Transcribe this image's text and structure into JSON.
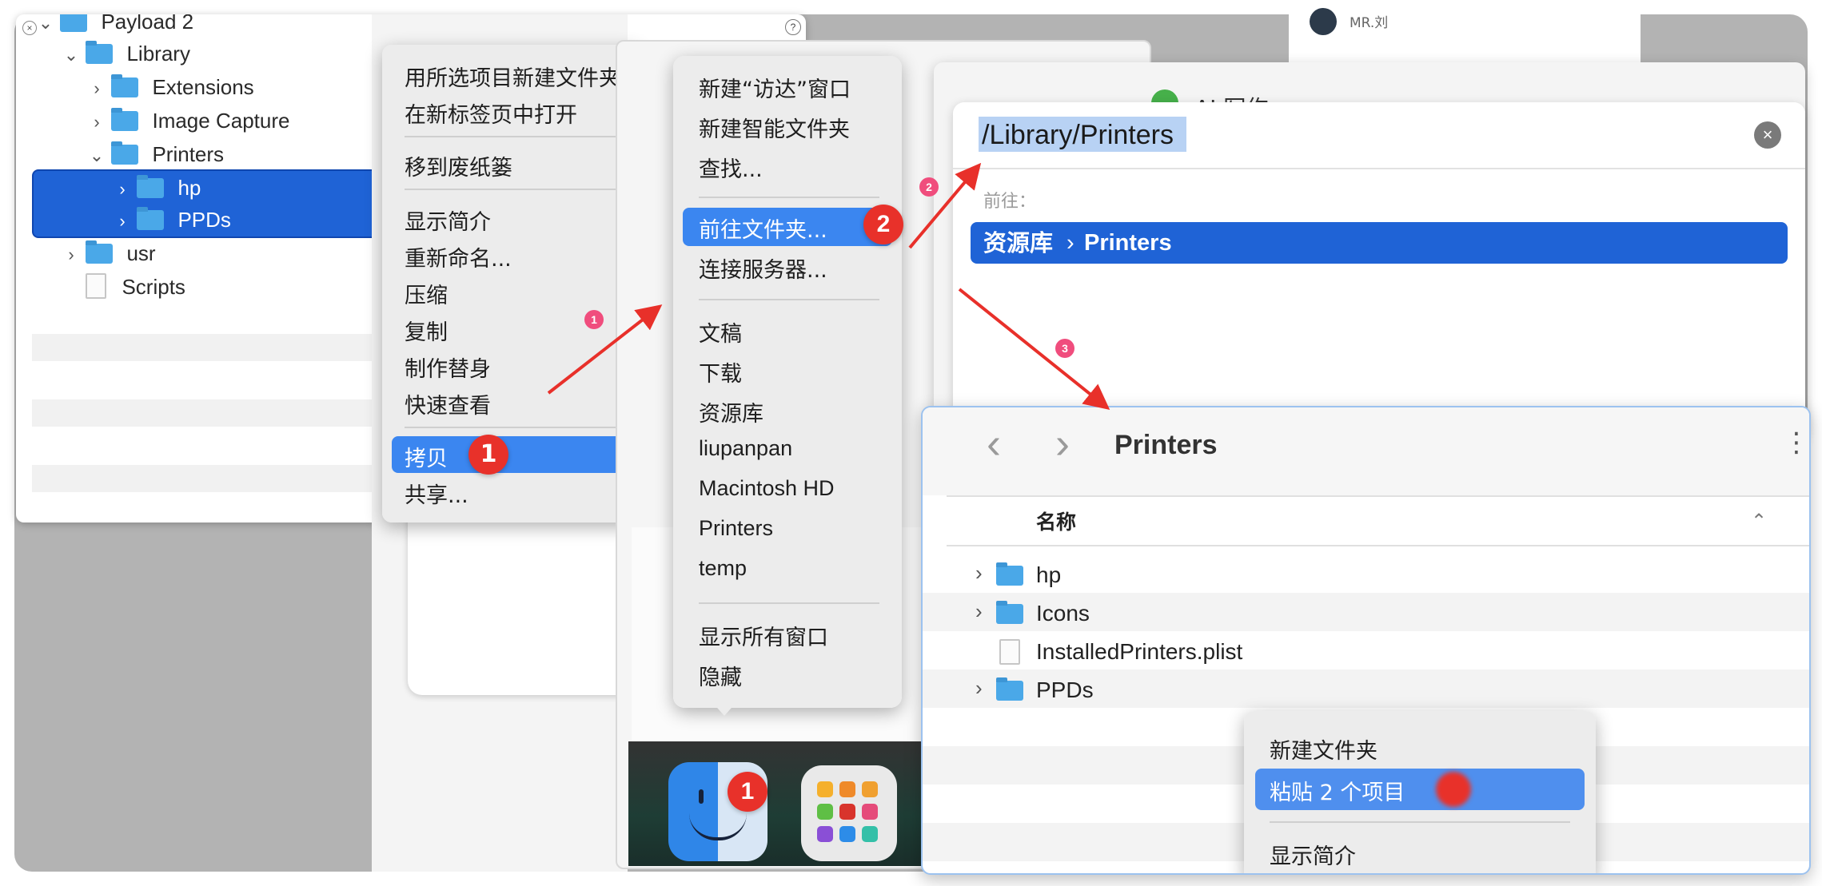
{
  "tree_window": {
    "root": "Payload 2",
    "items": [
      {
        "label": "Library",
        "kind": "folder",
        "chevron": "down"
      },
      {
        "label": "Extensions",
        "kind": "folder",
        "chevron": "right"
      },
      {
        "label": "Image Capture",
        "kind": "folder",
        "chevron": "right"
      },
      {
        "label": "Printers",
        "kind": "folder",
        "chevron": "down"
      },
      {
        "label": "hp",
        "kind": "folder",
        "chevron": "right",
        "selected": true
      },
      {
        "label": "PPDs",
        "kind": "folder",
        "chevron": "right",
        "selected": true
      },
      {
        "label": "usr",
        "kind": "folder",
        "chevron": "right"
      },
      {
        "label": "Scripts",
        "kind": "file",
        "chevron": ""
      }
    ]
  },
  "context_menu": {
    "items": [
      "用所选项目新建文件夹",
      "在新标签页中打开",
      "移到废纸篓",
      "显示简介",
      "重新命名...",
      "压缩",
      "复制",
      "制作替身",
      "快速查看",
      "拷贝",
      "共享..."
    ],
    "highlighted": "拷贝",
    "badge": "1"
  },
  "dock_menu": {
    "items": [
      "新建“访达”窗口",
      "新建智能文件夹",
      "查找...",
      "前往文件夹...",
      "连接服务器...",
      "文稿",
      "下载",
      "资源库",
      "liupanpan",
      "Macintosh HD",
      "Printers",
      "temp",
      "显示所有窗口",
      "隐藏"
    ],
    "highlighted": "前往文件夹...",
    "badge": "2"
  },
  "dock": {
    "finder_badge": "1"
  },
  "step_markers": [
    "1",
    "2",
    "3"
  ],
  "background_window": {
    "username": "MR.刘",
    "sidebar_item": "AI 写作"
  },
  "goto_panel": {
    "path_value": "/Library/Printers",
    "goto_label": "前往：",
    "suggestion_parent": "资源库",
    "suggestion_separator": "›",
    "suggestion_child": "Printers"
  },
  "printers_window": {
    "title": "Printers",
    "back": "‹",
    "forward": "›",
    "more": "⋮",
    "column_header": "名称",
    "sort": "⌃",
    "rows": [
      {
        "label": "hp",
        "kind": "folder"
      },
      {
        "label": "Icons",
        "kind": "folder"
      },
      {
        "label": "InstalledPrinters.plist",
        "kind": "file"
      },
      {
        "label": "PPDs",
        "kind": "folder"
      }
    ],
    "context_menu": [
      "新建文件夹",
      "粘贴 2 个项目",
      "显示简介"
    ],
    "highlighted": "粘贴 2 个项目"
  },
  "colors": {
    "selection": "#1f63d6",
    "menu_highlight": "#3b86f0",
    "badge": "#e8312a",
    "arrow": "#e8302a"
  }
}
